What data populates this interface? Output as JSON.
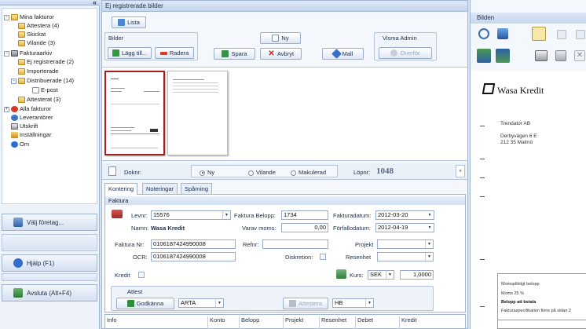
{
  "sidebar": {
    "collapse_glyph": "«",
    "tree": [
      {
        "label": "Mina fakturor",
        "toggle": "-",
        "icon": "folder",
        "level": 0
      },
      {
        "label": "Attestera (4)",
        "icon": "folder",
        "level": 1
      },
      {
        "label": "Skickat",
        "icon": "folder",
        "level": 1
      },
      {
        "label": "Vilande (3)",
        "icon": "folder",
        "level": 1
      },
      {
        "label": "Fakturaarkiv",
        "toggle": "-",
        "icon": "cabinet",
        "level": 0
      },
      {
        "label": "Ej registrerade (2)",
        "icon": "folder",
        "level": 1
      },
      {
        "label": "Importerade",
        "icon": "folder",
        "level": 1
      },
      {
        "label": "Distribuerade (14)",
        "toggle": "-",
        "icon": "folder",
        "level": 1
      },
      {
        "label": "E-post",
        "icon": "document",
        "level": 2
      },
      {
        "label": "Attesterat (3)",
        "icon": "folder",
        "level": 1
      },
      {
        "label": "Alla fakturor",
        "toggle": "+",
        "icon": "red-circle",
        "level": 0
      },
      {
        "label": "Leverantörer",
        "icon": "people",
        "level": 0
      },
      {
        "label": "Utskrift",
        "icon": "printer",
        "level": 0
      },
      {
        "label": "Inställningar",
        "icon": "tools",
        "level": 0
      },
      {
        "label": "Om",
        "icon": "info",
        "level": 0
      }
    ],
    "company_button": "Välj företag...",
    "help_button": "Hjälp (F1)",
    "exit_button": "Avsluta (Alt+F4)"
  },
  "main": {
    "title": "Ej registrerade bilder",
    "list_button": "Lista",
    "bilder_group": "Bilder",
    "add_button": "Lägg till...",
    "delete_button": "Radera",
    "new_button": "Ny",
    "save_button": "Spara",
    "cancel_button": "Avbryt",
    "mail_button": "Mall",
    "visma_group": "Visma Admin",
    "transfer_button": "Överför",
    "doknr_label": "Doknr:",
    "status_new": "Ny",
    "status_idle": "Vilande",
    "status_cancelled": "Makulerad",
    "lopnr_label": "Löpnr:",
    "lopnr_value": "1048",
    "tabs": [
      "Kontering",
      "Noteringar",
      "Spårning"
    ],
    "faktura_section": "Faktura",
    "levnr_label": "Levnr:",
    "levnr_value": "15576",
    "namn_label": "Namn:",
    "namn_value": "Wasa Kredit",
    "belopp_label": "Faktura Belopp:",
    "belopp_value": "1734",
    "moms_label": "Varav moms:",
    "moms_value": "0,00",
    "fakturadatum_label": "Fakturadatum:",
    "fakturadatum_value": "2012-03-20",
    "forfallodatum_label": "Förfallodatum:",
    "forfallodatum_value": "2012-04-19",
    "fakturanr_label": "Faktura Nr:",
    "fakturanr_value": "0106187424990008",
    "refnr_label": "Refnr:",
    "projekt_label": "Projekt",
    "ocr_label": "OCR:",
    "ocr_value": "0106187424990008",
    "diskretion_label": "Diskretion:",
    "resenhet_label": "Resenhet",
    "kredit_label": "Kredit",
    "kurs_label": "Kurs:",
    "currency_value": "SEK",
    "kurs_value": "1,0000",
    "attest_section": "Attest",
    "approve_button": "Godkänna",
    "approve_select": "ARTA",
    "attest_button": "Attestera",
    "attest_select": "HB",
    "columns": [
      "Info",
      "Konto",
      "Belopp",
      "Projekt",
      "Resenhet",
      "Debet",
      "Kredit"
    ]
  },
  "right": {
    "title": "Bilden",
    "doc_company": "Wasa Kredit",
    "doc_addr1": "Trendator AB",
    "doc_addr2": "Derbyvägen 6 E",
    "doc_addr3": "212 35 Malmö",
    "doc_foot1": "Momspliktigt belopp",
    "doc_foot2": "Moms 25 %",
    "doc_foot3": "Belopp att betala",
    "doc_foot4": "Fakturaspecifikation finns på sidan 2"
  }
}
